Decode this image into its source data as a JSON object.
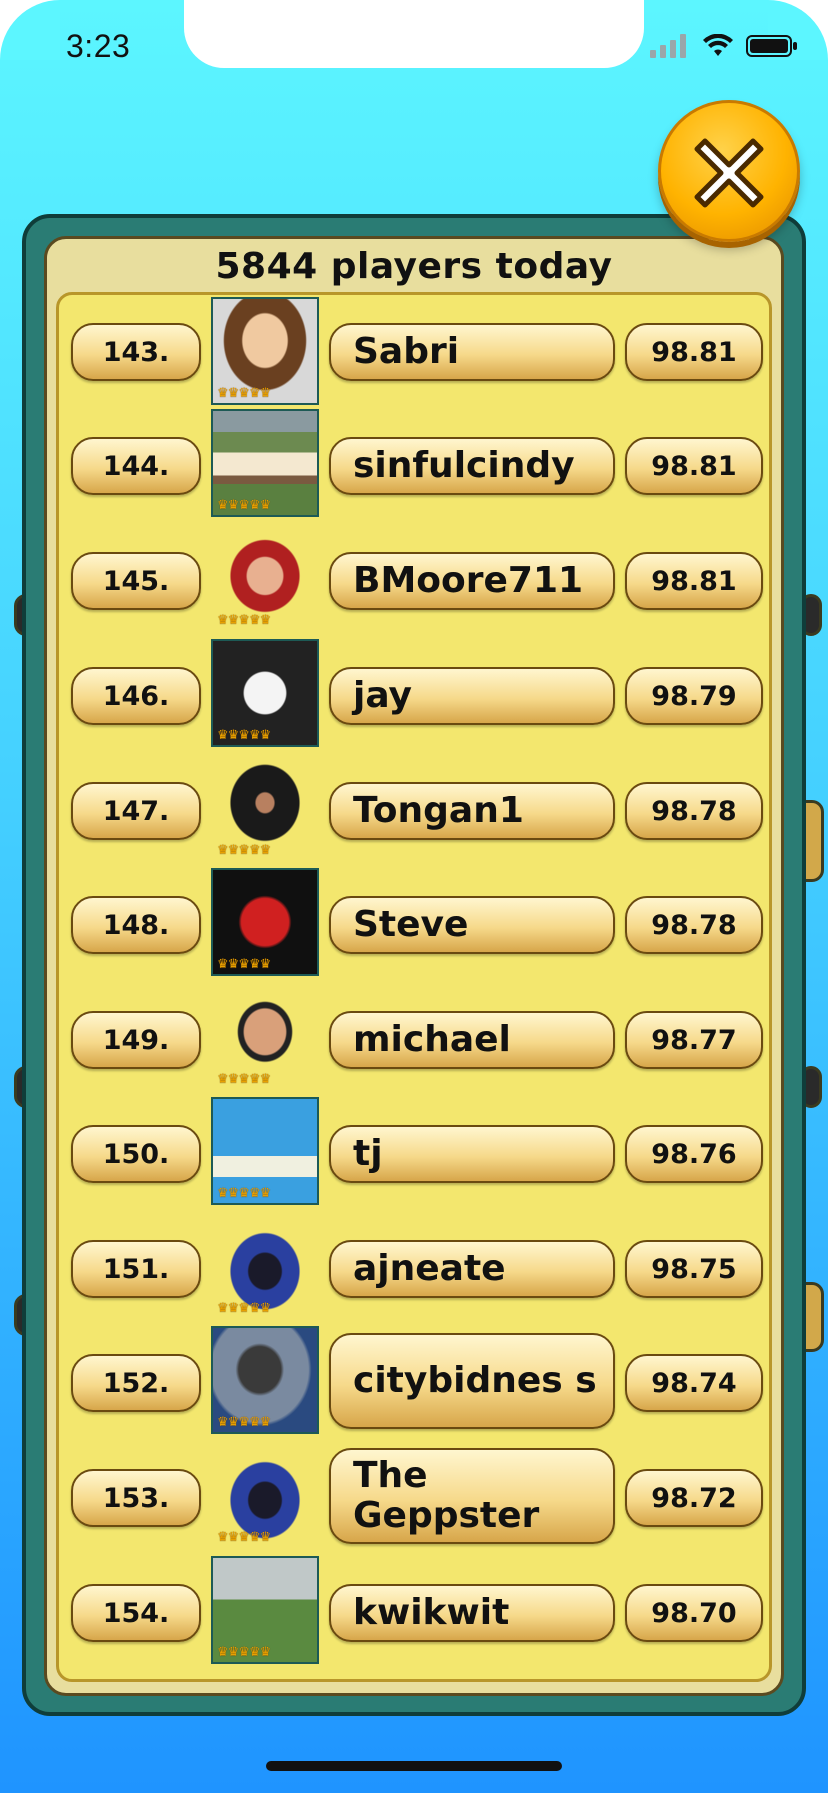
{
  "status_bar": {
    "time": "3:23"
  },
  "header": {
    "title": "5844 players today"
  },
  "rows": [
    {
      "rank": "143.",
      "name": "Sabri",
      "score": "98.81",
      "avatar": "portrait-woman",
      "crowns": "♛♛♛♛♛"
    },
    {
      "rank": "144.",
      "name": "sinfulcindy",
      "score": "98.81",
      "avatar": "garden-photo",
      "crowns": "♛♛♛♛♛"
    },
    {
      "rank": "145.",
      "name": "BMoore711",
      "score": "98.81",
      "avatar": "redhead-avatar",
      "crowns": "♛♛♛♛♛"
    },
    {
      "rank": "146.",
      "name": "jay",
      "score": "98.79",
      "avatar": "white-car",
      "crowns": "♛♛♛♛♛"
    },
    {
      "rank": "147.",
      "name": "Tongan1",
      "score": "98.78",
      "avatar": "ninja",
      "crowns": "♛♛♛♛♛"
    },
    {
      "rank": "148.",
      "name": "Steve",
      "score": "98.78",
      "avatar": "red-devil",
      "crowns": "♛♛♛♛♛"
    },
    {
      "rank": "149.",
      "name": "michael",
      "score": "98.77",
      "avatar": "man-avatar",
      "crowns": "♛♛♛♛♛"
    },
    {
      "rank": "150.",
      "name": "tj",
      "score": "98.76",
      "avatar": "cards-screenshot",
      "crowns": "♛♛♛♛♛"
    },
    {
      "rank": "151.",
      "name": "ajneate",
      "score": "98.75",
      "avatar": "hooded-figure",
      "crowns": "♛♛♛♛♛"
    },
    {
      "rank": "152.",
      "name": "citybidnes s",
      "score": "98.74",
      "avatar": "dog-photo",
      "crowns": "♛♛♛♛♛"
    },
    {
      "rank": "153.",
      "name": "The Geppster",
      "score": "98.72",
      "avatar": "hooded-figure",
      "crowns": "♛♛♛♛♛"
    },
    {
      "rank": "154.",
      "name": "kwikwit",
      "score": "98.70",
      "avatar": "soccer-photo",
      "crowns": "♛♛♛♛♛"
    }
  ]
}
